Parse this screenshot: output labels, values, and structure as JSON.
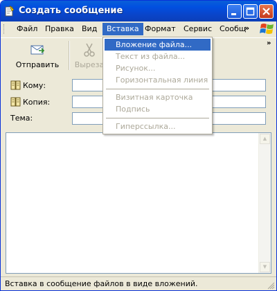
{
  "window": {
    "title": "Создать сообщение"
  },
  "menubar": {
    "items": [
      "Файл",
      "Правка",
      "Вид",
      "Вставка",
      "Формат",
      "Сервис",
      "Сообщ"
    ],
    "more": "»"
  },
  "toolbar": {
    "send_label": "Отправить",
    "cut_label": "Выреза",
    "more": "»"
  },
  "fields": {
    "to_label": "Кому:",
    "cc_label": "Копия:",
    "subject_label": "Тема:",
    "to_value": "",
    "cc_value": "",
    "subject_value": ""
  },
  "message_body": "",
  "insert_menu": {
    "items": [
      {
        "label": "Вложение файла...",
        "enabled": true
      },
      {
        "label": "Текст из файла...",
        "enabled": false
      },
      {
        "label": "Рисунок...",
        "enabled": false
      },
      {
        "label": "Горизонтальная линия",
        "enabled": false
      },
      {
        "label": "Визитная карточка",
        "enabled": false
      },
      {
        "label": "Подпись",
        "enabled": false
      },
      {
        "label": "Гиперссылка...",
        "enabled": false
      }
    ]
  },
  "statusbar": {
    "text": "Вставка в сообщение файлов в виде вложений."
  },
  "icons": {
    "app": "new-message-icon",
    "send": "send-icon",
    "cut": "scissors-icon",
    "address_book": "address-book-icon",
    "windows": "windows-logo-icon"
  },
  "colors": {
    "titlebar": "#0a5fd8",
    "highlight": "#316ac5",
    "disabled_text": "#aca899",
    "chrome": "#ece9d8"
  }
}
